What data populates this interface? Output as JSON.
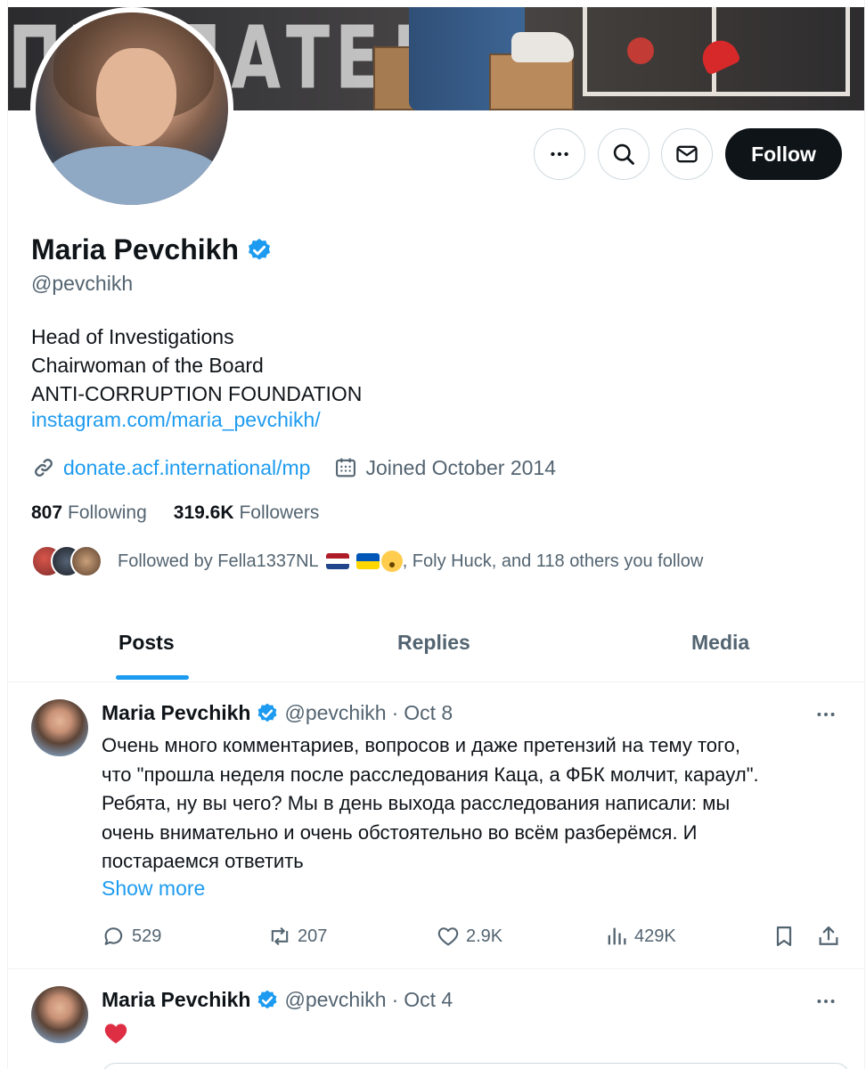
{
  "banner": {
    "text": "ПРЕДАТЕЛИ"
  },
  "actions": {
    "more_icon": "more-horizontal-icon",
    "search_icon": "search-icon",
    "message_icon": "envelope-icon",
    "follow_label": "Follow"
  },
  "profile": {
    "name": "Maria Pevchikh",
    "handle": "@pevchikh",
    "bio_lines": [
      "Head of Investigations",
      "Chairwoman of the Board",
      "ANTI-CORRUPTION FOUNDATION"
    ],
    "bio_link": "instagram.com/maria_pevchikh/",
    "website": "donate.acf.international/mp",
    "joined": "Joined October 2014",
    "following_count": "807",
    "following_label": "Following",
    "followers_count": "319.6K",
    "followers_label": "Followers",
    "followed_by_prefix": "Followed by Fella1337NL",
    "followed_by_suffix": ", Foly Huck, and 118 others you follow"
  },
  "tabs": [
    {
      "label": "Posts",
      "active": true
    },
    {
      "label": "Replies",
      "active": false
    },
    {
      "label": "Media",
      "active": false
    }
  ],
  "posts": [
    {
      "author": "Maria Pevchikh",
      "handle": "@pevchikh",
      "separator": "·",
      "date": "Oct 8",
      "text_lines": [
        "Очень много комментариев, вопросов и даже претензий на тему того,",
        "что \"прошла неделя после расследования Каца, а ФБК молчит, караул\".",
        "Ребята, ну вы чего? Мы в день выхода расследования написали: мы",
        "очень внимательно и очень обстоятельно во всём разберёмся. И",
        "постараемся ответить"
      ],
      "show_more": "Show more",
      "replies": "529",
      "reposts": "207",
      "likes": "2.9K",
      "views": "429K"
    },
    {
      "author": "Maria Pevchikh",
      "handle": "@pevchikh",
      "separator": "·",
      "date": "Oct 4",
      "content_icon": "red-heart-icon"
    }
  ],
  "colors": {
    "accent": "#1d9bf0",
    "text_primary": "#0f1419",
    "text_secondary": "#536471",
    "border": "#cfd9de",
    "follow_bg": "#0f1419",
    "heart": "#dd2e44"
  }
}
